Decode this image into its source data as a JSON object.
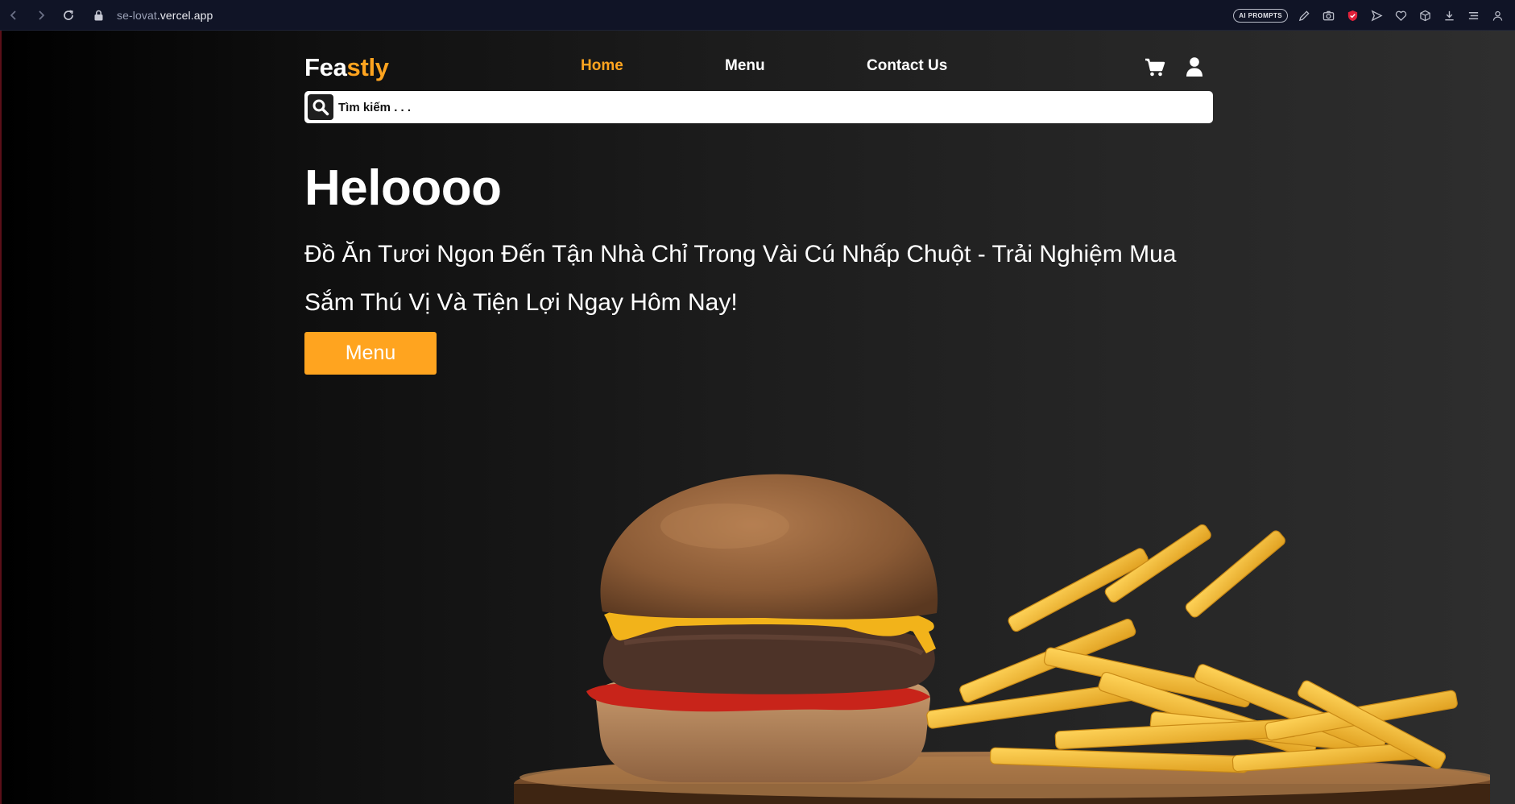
{
  "browser": {
    "url_host_prefix": "se-lovat",
    "url_host_rest": ".vercel.app",
    "ai_pill_label": "AI PROMPTS"
  },
  "header": {
    "logo_part1": "Fea",
    "logo_part2": "stly",
    "nav": [
      {
        "label": "Home",
        "active": true
      },
      {
        "label": "Menu",
        "active": false
      },
      {
        "label": "Contact Us",
        "active": false
      }
    ],
    "icons": [
      "cart-icon",
      "user-icon"
    ]
  },
  "search": {
    "placeholder": "Tìm kiếm . . ."
  },
  "hero": {
    "title": "Heloooo",
    "subtitle": "Đồ Ăn Tươi Ngon Đến Tận Nhà Chỉ Trong Vài Cú Nhấp Chuột - Trải Nghiệm Mua Sắm Thú Vị Và Tiện Lợi Ngay Hôm Nay!",
    "button_label": "Menu"
  },
  "colors": {
    "accent": "#ffa41f",
    "chrome_bg": "#101426",
    "page_dark": "#000000",
    "page_light": "#2e2e2e"
  }
}
